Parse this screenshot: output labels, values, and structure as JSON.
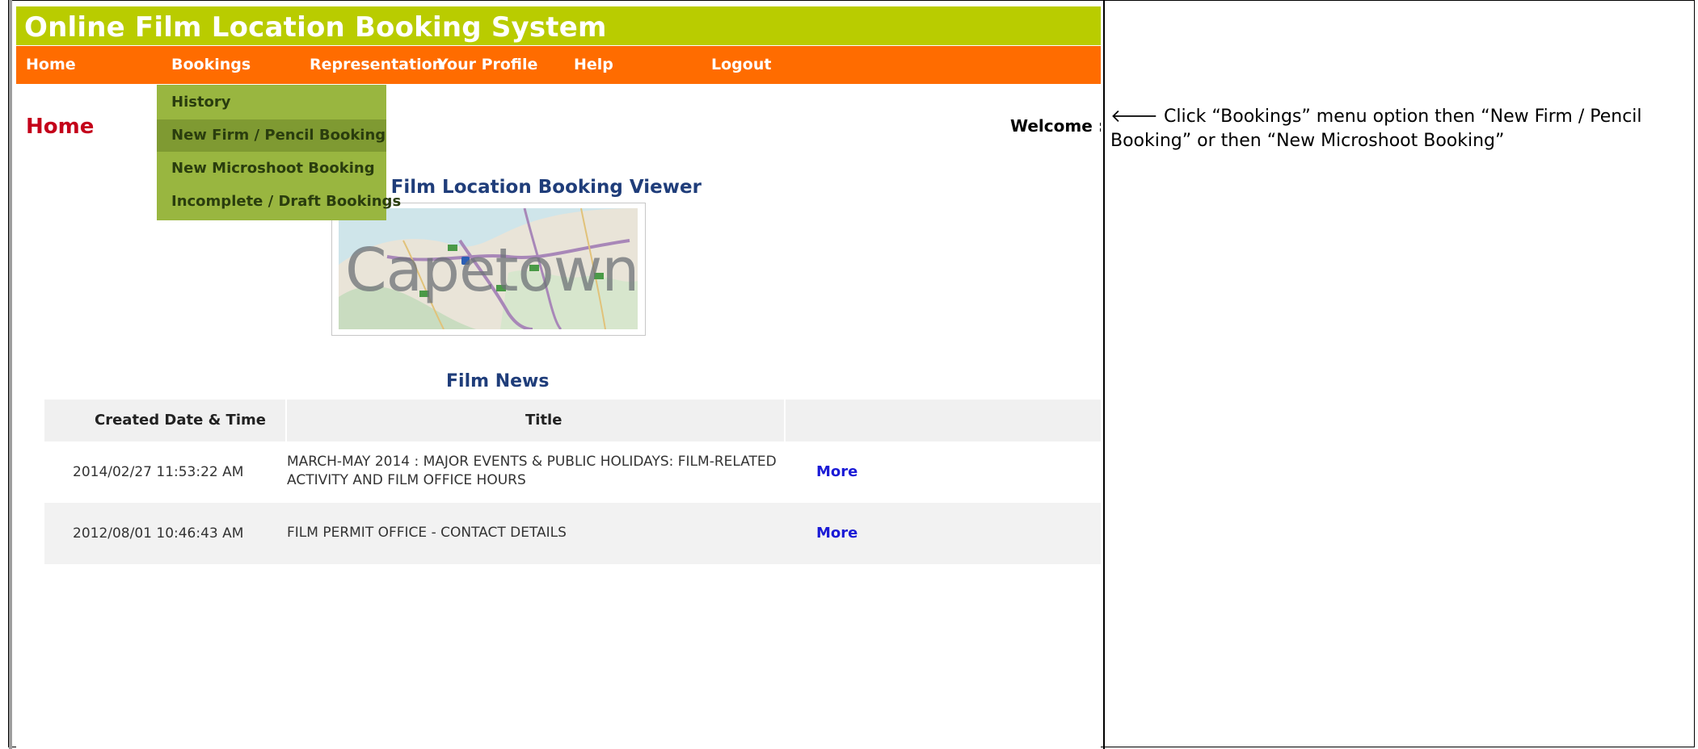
{
  "app": {
    "title": "Online Film Location Booking System"
  },
  "nav": {
    "items": [
      {
        "label": "Home"
      },
      {
        "label": "Bookings"
      },
      {
        "label": "Representation"
      },
      {
        "label": "Your Profile"
      },
      {
        "label": "Help"
      },
      {
        "label": "Logout"
      }
    ]
  },
  "bookings_menu": {
    "items": [
      {
        "label": "History"
      },
      {
        "label": "New Firm / Pencil Booking",
        "highlighted": true
      },
      {
        "label": "New Microshoot Booking"
      },
      {
        "label": "Incomplete / Draft Bookings"
      }
    ]
  },
  "page": {
    "title": "Home",
    "welcome": "Welcome :"
  },
  "viewer": {
    "title": "e Film Location Booking Viewer",
    "map_caption": "Capetown"
  },
  "news": {
    "title": "Film News",
    "columns": [
      "Created Date & Time",
      "Title"
    ],
    "rows": [
      {
        "date": "2014/02/27 11:53:22 AM",
        "title": "MARCH-MAY 2014 : MAJOR EVENTS & PUBLIC HOLIDAYS: FILM-RELATED ACTIVITY AND FILM OFFICE HOURS",
        "more": "More"
      },
      {
        "date": "2012/08/01 10:46:43 AM",
        "title": "FILM PERMIT OFFICE - CONTACT DETAILS",
        "more": "More"
      }
    ]
  },
  "instructions": {
    "arrow": "🡐",
    "text": "Click “Bookings” menu option then “New Firm / Pencil Booking” or then “New Microshoot Booking”"
  },
  "colors": {
    "title_bar": "#b9cc00",
    "nav_bar": "#ff6c00",
    "dropdown": "#99b640",
    "dropdown_highlight": "#7f9a32",
    "page_title": "#c4001a",
    "heading_blue": "#1f3d7a",
    "link": "#1b1bd6"
  }
}
